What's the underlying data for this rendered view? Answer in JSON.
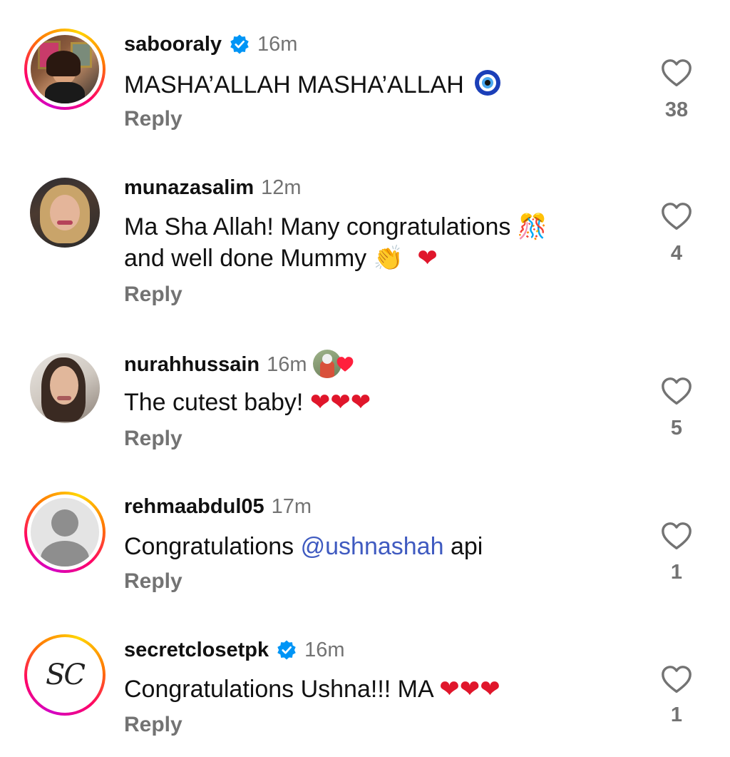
{
  "comments": [
    {
      "username": "sabooraly",
      "verified": true,
      "time": "16m",
      "text": "MASHA’ALLAH MASHA’ALLAH",
      "emoji": "🧿",
      "reply": "Reply",
      "likes": "38"
    },
    {
      "username": "munazasalim",
      "verified": false,
      "time": "12m",
      "text_line1": "Ma Sha Allah!  Many congratulations",
      "emoji1": "🎊",
      "text_line2": "and well done Mummy",
      "emoji2": "👏",
      "emoji3": "❤",
      "reply": "Reply",
      "likes": "4"
    },
    {
      "username": "nurahhussain",
      "verified": false,
      "time": "16m",
      "text": "The cutest baby!",
      "emoji": "❤❤❤",
      "reply": "Reply",
      "likes": "5"
    },
    {
      "username": "rehmaabdul05",
      "verified": false,
      "time": "17m",
      "text_before": "Congratulations",
      "mention": "@ushnashah",
      "text_after": "api",
      "reply": "Reply",
      "likes": "1"
    },
    {
      "username": "secretclosetpk",
      "verified": true,
      "time": "16m",
      "text": "Congratulations Ushna!!! MA",
      "emoji": "❤❤❤",
      "reply": "Reply",
      "likes": "1",
      "avatar_initials": "SC"
    }
  ],
  "colors": {
    "verified": "#0095f6",
    "muted": "#737373",
    "mention": "#3f5ac0",
    "heart": "#e0162b"
  }
}
